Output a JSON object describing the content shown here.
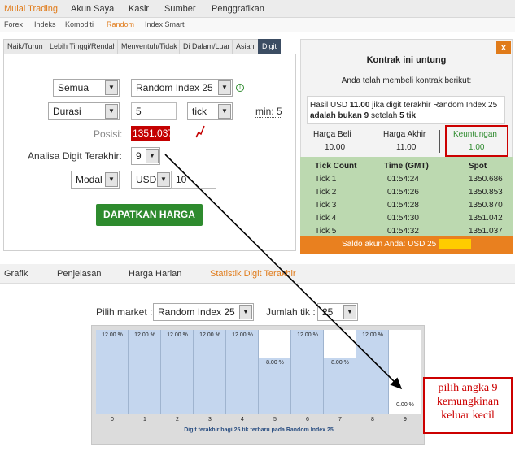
{
  "topnav": [
    "Mulai Trading",
    "Akun Saya",
    "Kasir",
    "Sumber",
    "Penggrafikan"
  ],
  "subnav": [
    "Forex",
    "Indeks",
    "Komoditi",
    "Random",
    "Index Smart"
  ],
  "contract_tabs": [
    "Naik/Turun",
    "Lebih Tinggi/Rendah",
    "Menyentuh/Tidak",
    "Di Dalam/Luar",
    "Asian",
    "Digit"
  ],
  "form": {
    "market_type": "Semua",
    "underlying": "Random Index 25",
    "duration_type": "Durasi",
    "duration_value": "5",
    "duration_unit": "tick",
    "min_label": "min: 5",
    "spot_label": "Posisi:",
    "spot_value": "1351.037",
    "digit_label": "Analisa Digit Terakhir:",
    "digit_value": "9",
    "amount_type": "Modal",
    "currency": "USD",
    "amount": "10",
    "get_price_button": "DAPATKAN HARGA"
  },
  "contract": {
    "close": "x",
    "title": "Kontrak ini untung",
    "subtitle": "Anda telah membeli kontrak berikut:",
    "summary_pre": "Hasil USD ",
    "summary_amount": "11.00",
    "summary_mid": " jika digit terakhir Random Index 25 ",
    "summary_bold": "adalah bukan 9",
    "summary_post1": " setelah ",
    "summary_ticks": "5 tik",
    "summary_post2": ".",
    "buy_price_label": "Harga Beli",
    "buy_price": "10.00",
    "final_price_label": "Harga Akhir",
    "final_price": "11.00",
    "profit_label": "Keuntungan",
    "profit": "1.00",
    "headers": [
      "Tick Count",
      "Time (GMT)",
      "Spot"
    ],
    "rows": [
      [
        "Tick 1",
        "01:54:24",
        "1350.686"
      ],
      [
        "Tick 2",
        "01:54:26",
        "1350.853"
      ],
      [
        "Tick 3",
        "01:54:28",
        "1350.870"
      ],
      [
        "Tick 4",
        "01:54:30",
        "1351.042"
      ],
      [
        "Tick 5",
        "01:54:32",
        "1351.037"
      ]
    ],
    "balance_label": "Saldo akun Anda: USD 25",
    "colors": {
      "orange": "#e9801f",
      "green": "#2e8b2e",
      "red": "#cc0000"
    }
  },
  "bottom_tabs": [
    "Grafik",
    "Penjelasan",
    "Harga Harian",
    "Statistik Digit Terakhir"
  ],
  "stats": {
    "market_label": "Pilih market :",
    "market_value": "Random Index 25",
    "ticks_label": "Jumlah tik :",
    "ticks_value": "25"
  },
  "note": "pilih angka 9 kemungkinan keluar kecil",
  "chart_data": {
    "type": "bar",
    "categories": [
      "0",
      "1",
      "2",
      "3",
      "4",
      "5",
      "6",
      "7",
      "8",
      "9"
    ],
    "values": [
      12.0,
      12.0,
      12.0,
      12.0,
      12.0,
      8.0,
      12.0,
      8.0,
      12.0,
      0.0
    ],
    "value_labels": [
      "12.00 %",
      "12.00 %",
      "12.00 %",
      "12.00 %",
      "12.00 %",
      "8.00 %",
      "12.00 %",
      "8.00 %",
      "12.00 %",
      "0.00 %"
    ],
    "title": "",
    "xlabel": "Digit terakhir bagi 25 tik terbaru pada Random Index 25",
    "ylabel": "",
    "ylim": [
      0,
      12
    ]
  }
}
